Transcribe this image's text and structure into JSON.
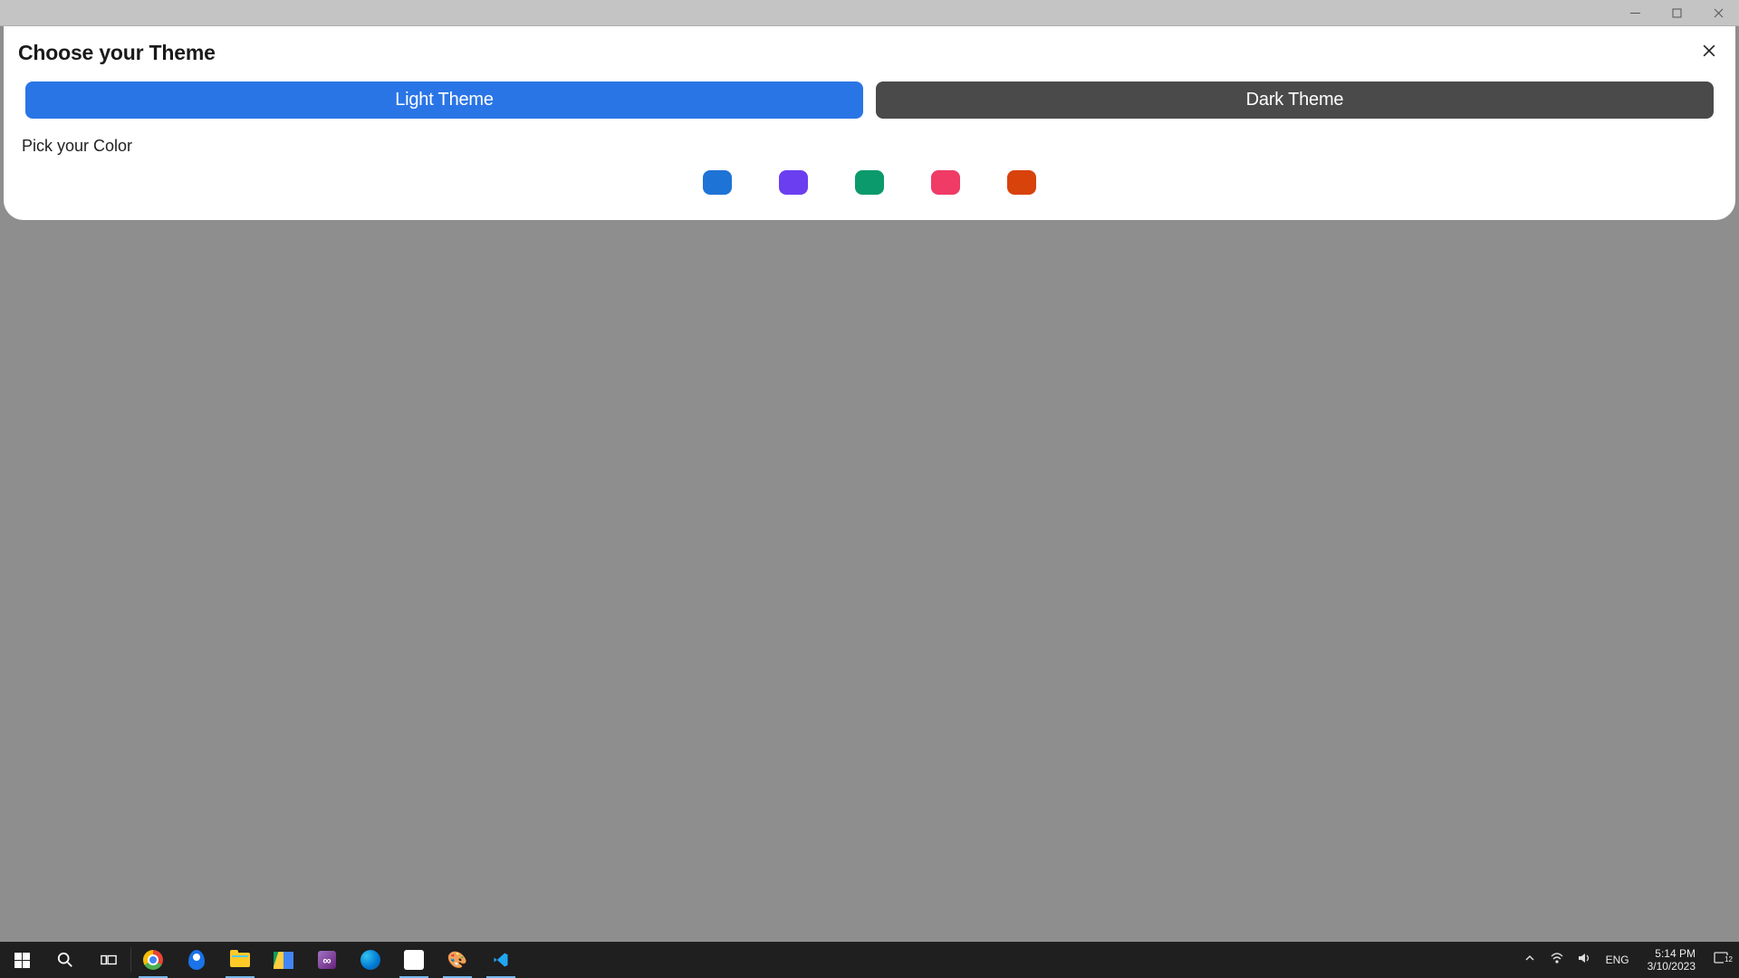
{
  "dialog": {
    "title": "Choose your Theme",
    "light_label": "Light Theme",
    "dark_label": "Dark Theme",
    "pick_label": "Pick your Color",
    "swatches": {
      "c0": "#1e73d6",
      "c1": "#6b3ff0",
      "c2": "#0b9a6b",
      "c3": "#ef3b66",
      "c4": "#d8420b"
    }
  },
  "taskbar": {
    "lang": "ENG",
    "time": "5:14 PM",
    "date": "3/10/2023",
    "notif_count": "12"
  }
}
